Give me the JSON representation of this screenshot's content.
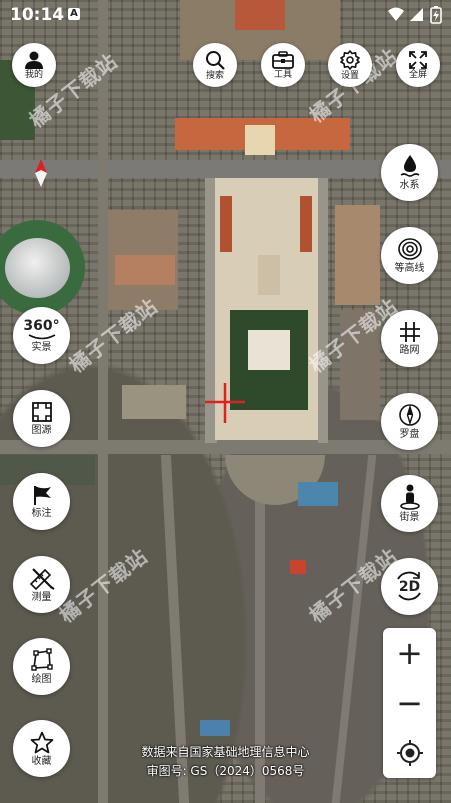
{
  "status_bar": {
    "time": "10:14",
    "notification": "A"
  },
  "top_buttons": {
    "profile": "我的",
    "search": "搜索",
    "tools": "工具",
    "settings": "设置",
    "fullscreen": "全屏"
  },
  "right_buttons": {
    "water": "水系",
    "contour": "等高线",
    "roads": "路网",
    "compass": "罗盘",
    "street_view": "街景",
    "view_2d": "2D"
  },
  "left_buttons": {
    "view_360": "实景",
    "view_360_badge": "360°",
    "layers": "图源",
    "markers": "标注",
    "measure": "测量",
    "draw": "绘图",
    "favorites": "收藏"
  },
  "zoom": {
    "in": "+",
    "out": "−"
  },
  "watermark": "橘子下载站",
  "credits": {
    "line1": "数据来自国家基础地理信息中心",
    "line2": "审图号: GS（2024）0568号"
  },
  "colors": {
    "button_bg": "#ffffff",
    "icon": "#222222",
    "crosshair": "#e02020",
    "location_pin": "#e02020"
  }
}
